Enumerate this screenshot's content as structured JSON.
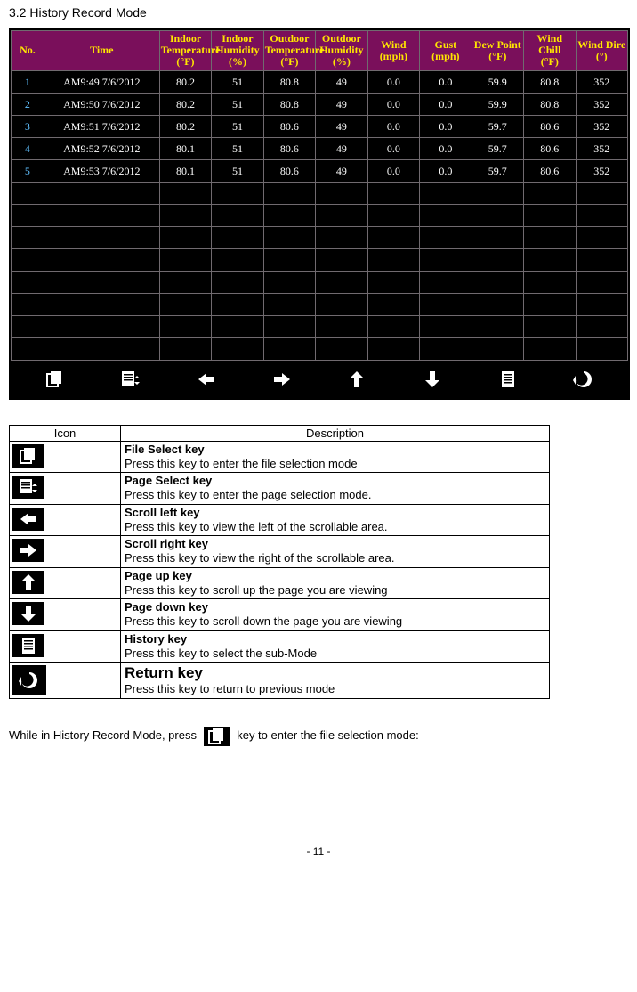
{
  "section_title": "3.2 History Record Mode",
  "headers": [
    "No.",
    "Time",
    "Indoor Temperature (°F)",
    "Indoor Humidity (%)",
    "Outdoor Temperature (°F)",
    "Outdoor Humidity (%)",
    "Wind (mph)",
    "Gust (mph)",
    "Dew Point (°F)",
    "Wind Chill (°F)",
    "Wind Dire (°)"
  ],
  "rows": [
    {
      "no": "1",
      "time": "AM9:49 7/6/2012",
      "c": [
        "80.2",
        "51",
        "80.8",
        "49",
        "0.0",
        "0.0",
        "59.9",
        "80.8",
        "352"
      ]
    },
    {
      "no": "2",
      "time": "AM9:50 7/6/2012",
      "c": [
        "80.2",
        "51",
        "80.8",
        "49",
        "0.0",
        "0.0",
        "59.9",
        "80.8",
        "352"
      ]
    },
    {
      "no": "3",
      "time": "AM9:51 7/6/2012",
      "c": [
        "80.2",
        "51",
        "80.6",
        "49",
        "0.0",
        "0.0",
        "59.7",
        "80.6",
        "352"
      ]
    },
    {
      "no": "4",
      "time": "AM9:52 7/6/2012",
      "c": [
        "80.1",
        "51",
        "80.6",
        "49",
        "0.0",
        "0.0",
        "59.7",
        "80.6",
        "352"
      ]
    },
    {
      "no": "5",
      "time": "AM9:53 7/6/2012",
      "c": [
        "80.1",
        "51",
        "80.6",
        "49",
        "0.0",
        "0.0",
        "59.7",
        "80.6",
        "352"
      ]
    }
  ],
  "empty_row_count": 8,
  "desc_headers": {
    "icon": "Icon",
    "desc": "Description"
  },
  "descriptions": [
    {
      "title": "File Select key",
      "body": "Press this key to enter the file selection mode",
      "icon": "file-select"
    },
    {
      "title": "Page Select key",
      "body": "Press this key to enter the page selection mode.",
      "icon": "page-select"
    },
    {
      "title": "Scroll left key",
      "body": "Press this key to view the left of the scrollable area.",
      "icon": "arrow-left"
    },
    {
      "title": "Scroll right key",
      "body": "Press this key to view the right of the scrollable area.",
      "icon": "arrow-right"
    },
    {
      "title": "Page up key",
      "body": "Press this key to scroll up the page you are viewing",
      "icon": "arrow-up"
    },
    {
      "title": "Page down key",
      "body": "Press this key to scroll down the page you are viewing",
      "icon": "arrow-down"
    },
    {
      "title": "History key",
      "body": "Press this key to select the sub-Mode",
      "icon": "history"
    },
    {
      "title": "Return key",
      "body": "Press this key to return to previous mode",
      "icon": "return",
      "big": true
    }
  ],
  "bottom_icons": [
    "file-select",
    "page-select",
    "arrow-left",
    "arrow-right",
    "arrow-up",
    "arrow-down",
    "history",
    "return"
  ],
  "footer_text_a": "While in History Record Mode, press",
  "footer_text_b": "key to enter the file selection mode:",
  "page_number": "- 11 -"
}
